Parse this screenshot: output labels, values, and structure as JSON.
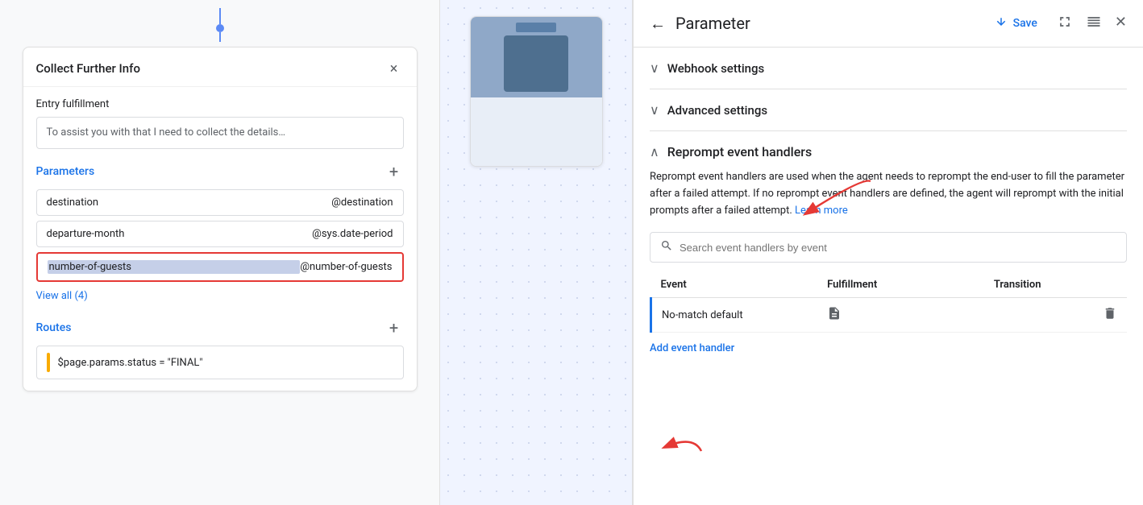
{
  "leftPanel": {
    "connectorVisible": true,
    "card": {
      "title": "Collect Further Info",
      "closeLabel": "×",
      "entryFulfillment": {
        "sectionLabel": "Entry fulfillment",
        "textValue": "To assist you with that I need to collect the details…"
      },
      "parameters": {
        "sectionTitle": "Parameters",
        "addLabel": "+",
        "rows": [
          {
            "name": "destination",
            "value": "@destination",
            "selected": false
          },
          {
            "name": "departure-month",
            "value": "@sys.date-period",
            "selected": false
          },
          {
            "name": "number-of-guests",
            "value": "@number-of-guests",
            "selected": true
          }
        ],
        "viewAll": "View all (4)"
      },
      "routes": {
        "sectionTitle": "Routes",
        "addLabel": "+",
        "rows": [
          {
            "text": "$page.params.status = \"FINAL\""
          }
        ]
      }
    }
  },
  "rightPanel": {
    "header": {
      "backLabel": "←",
      "title": "Parameter",
      "saveLabel": "Save",
      "saveIconLabel": "save-icon",
      "expandIconLabel": "expand-icon",
      "splitIconLabel": "split-icon",
      "closeIconLabel": "close-icon"
    },
    "webhookSettings": {
      "title": "Webhook settings"
    },
    "advancedSettings": {
      "title": "Advanced settings"
    },
    "repromptSection": {
      "title": "Reprompt event handlers",
      "description": "Reprompt event handlers are used when the agent needs to reprompt the end-user to fill the parameter after a failed attempt. If no reprompt event handlers are defined, the agent will reprompt with the initial prompts after a failed attempt.",
      "learnMore": "Learn more",
      "searchPlaceholder": "Search event handlers by event",
      "tableHeaders": {
        "event": "Event",
        "fulfillment": "Fulfillment",
        "transition": "Transition"
      },
      "rows": [
        {
          "event": "No-match default",
          "fulfillment": "doc-icon",
          "transition": ""
        }
      ],
      "addEventHandler": "Add event handler"
    }
  }
}
